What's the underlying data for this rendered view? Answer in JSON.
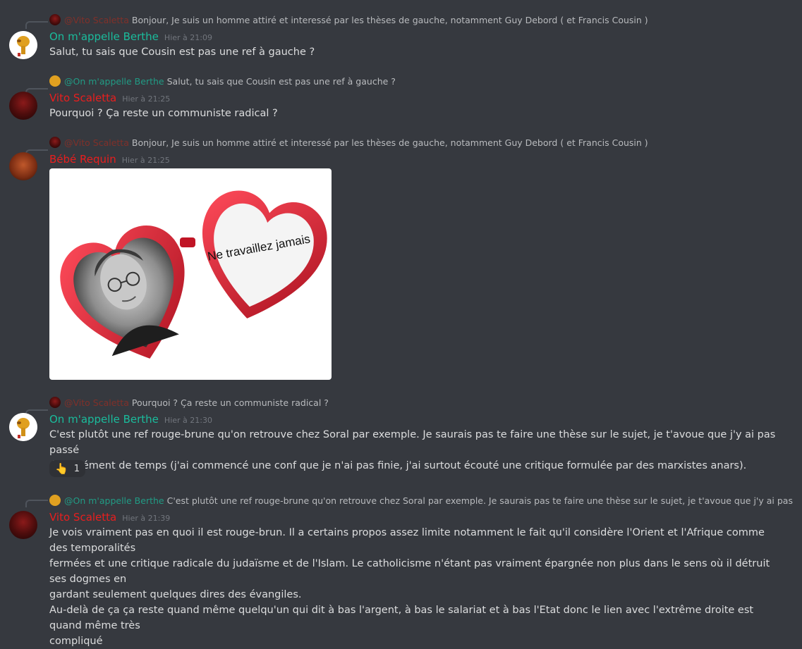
{
  "messages": [
    {
      "reply_author": "@Vito Scaletta",
      "reply_text": "Bonjour, Je suis un homme attiré et interessé par les thèses de gauche, notamment Guy Debord ( et Francis Cousin )",
      "author": "On m'appelle Berthe",
      "time": "Hier à 21:09",
      "text": "Salut, tu sais que Cousin est pas une ref à gauche ?"
    },
    {
      "reply_author": "@On m'appelle Berthe",
      "reply_text": "Salut, tu sais que Cousin est pas une ref à gauche ?",
      "author": "Vito Scaletta",
      "time": "Hier à 21:25",
      "text": "Pourquoi ? Ça reste un communiste radical ?"
    },
    {
      "reply_author": "@Vito Scaletta",
      "reply_text": "Bonjour, Je suis un homme attiré et interessé par les thèses de gauche, notamment Guy Debord ( et Francis Cousin )",
      "author": "Bébé Requin",
      "time": "Hier à 21:25",
      "image_caption": "Ne travaillez jamais"
    },
    {
      "reply_author": "@Vito Scaletta",
      "reply_text": "Pourquoi ? Ça reste un communiste radical ?",
      "author": "On m'appelle Berthe",
      "time": "Hier à 21:30",
      "text_lines": [
        "C'est plutôt une ref rouge-brune qu'on retrouve chez Soral par exemple. Je saurais pas te faire une thèse sur le sujet, je t'avoue que j'y ai pas passé",
        "énormément de temps (j'ai commencé une conf que je n'ai pas finie, j'ai surtout écouté une critique formulée par des marxistes anars)."
      ],
      "reaction_emoji": "👆",
      "reaction_count": "1"
    },
    {
      "reply_author": "@On m'appelle Berthe",
      "reply_text": "C'est plutôt une ref rouge-brune qu'on retrouve chez Soral par exemple. Je saurais pas te faire une thèse sur le sujet, je t'avoue que j'y ai pas passé énorm...",
      "author": "Vito Scaletta",
      "time": "Hier à 21:39",
      "text_lines": [
        "Je vois vraiment pas en quoi il est rouge-brun. Il a certains propos assez limite notamment le fait qu'il considère l'Orient et l'Afrique comme des temporalités",
        "fermées et une critique radicale du judaïsme et de l'Islam. Le catholicisme n'étant pas vraiment épargnée non plus dans le sens où il détruit ses dogmes en",
        "gardant seulement quelques dires des évangiles.",
        "Au-delà de ça ça reste quand même quelqu'un qui dit à bas l'argent, à bas le salariat et à bas l'Etat donc le lien avec l'extrême droite est quand même très",
        "compliqué"
      ]
    }
  ],
  "colors": {
    "background": "#36393f",
    "teal_name": "#1abc9c",
    "red_name": "#e91e1e",
    "muted": "#72767d"
  }
}
